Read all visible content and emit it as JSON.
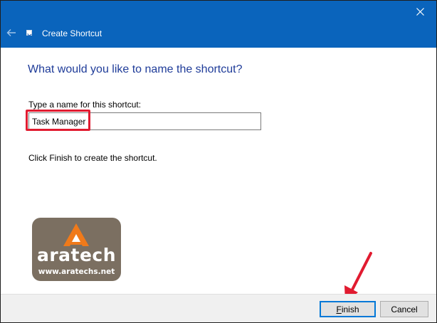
{
  "window": {
    "title": "Create Shortcut"
  },
  "page": {
    "heading": "What would you like to name the shortcut?",
    "name_label": "Type a name for this shortcut:",
    "name_value": "Task Manager",
    "instruction": "Click Finish to create the shortcut."
  },
  "watermark": {
    "brand": "aratech",
    "url": "www.aratechs.net"
  },
  "footer": {
    "finish_label_rest": "inish",
    "finish_label_first": "F",
    "cancel_label": "Cancel"
  },
  "colors": {
    "titlebar": "#0a64bc",
    "heading": "#1f3c99",
    "highlight": "#e11b30",
    "logo_bg": "#7b6f61",
    "logo_accent": "#f07a1a"
  },
  "icons": {
    "close": "close-icon",
    "back": "back-arrow-icon",
    "app": "shortcut-icon"
  }
}
